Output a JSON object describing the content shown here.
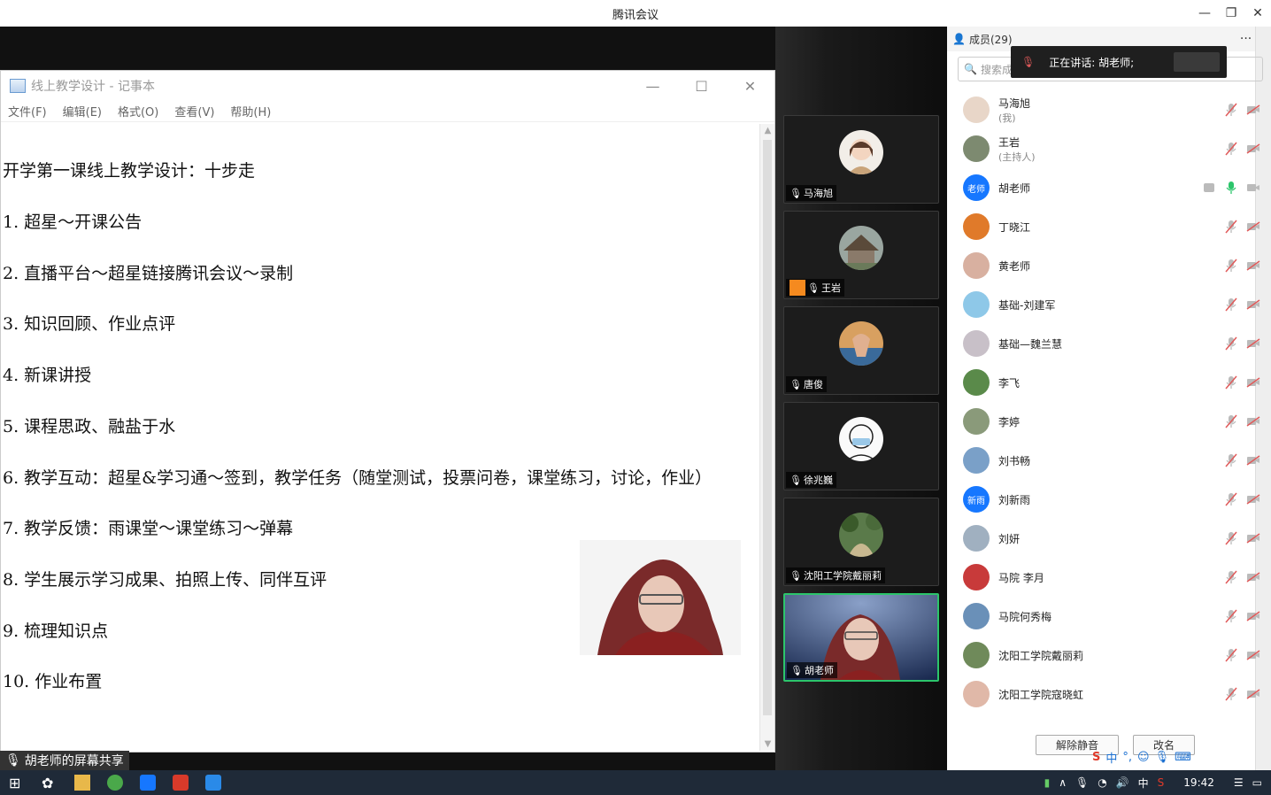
{
  "window": {
    "title": "腾讯会议",
    "min": "—",
    "max": "❐",
    "close": "✕"
  },
  "notepad": {
    "title": "线上教学设计 - 记事本",
    "menu": [
      "文件(F)",
      "编辑(E)",
      "格式(O)",
      "查看(V)",
      "帮助(H)"
    ],
    "lines": [
      "开学第一课线上教学设计：十步走",
      "1. 超星～开课公告",
      "2. 直播平台～超星链接腾讯会议～录制",
      "3. 知识回顾、作业点评",
      "4. 新课讲授",
      "5. 课程思政、融盐于水",
      "6. 教学互动：超星&学习通～签到，教学任务（随堂测试，投票问卷，课堂练习，讨论，作业）",
      "7. 教学反馈：雨课堂～课堂练习～弹幕",
      "8. 学生展示学习成果、拍照上传、同伴互评",
      "9. 梳理知识点",
      "10. 作业布置"
    ]
  },
  "share_label": "胡老师的屏幕共享",
  "video_tiles": [
    {
      "name": "马海旭",
      "color": "#d9c9b8"
    },
    {
      "name": "王岩",
      "color": "#7d8a70"
    },
    {
      "name": "唐俊",
      "color": "#c58a4a"
    },
    {
      "name": "徐兆巍",
      "color": "#f2f2f2"
    },
    {
      "name": "沈阳工学院戴丽莉",
      "color": "#6f8a5a"
    },
    {
      "name": "胡老师",
      "color": "#3a4a70"
    }
  ],
  "panel": {
    "title": "成员(29)",
    "more": "···",
    "close": "✕",
    "search_placeholder": "搜索成",
    "toast": "正在讲话: 胡老师;",
    "buttons": [
      "解除静音",
      "改名"
    ],
    "members": [
      {
        "name": "马海旭",
        "sub": "(我)",
        "avatar": "#e8d6c8",
        "label": ""
      },
      {
        "name": "王岩",
        "sub": "(主持人)",
        "avatar": "#7d8a70",
        "label": ""
      },
      {
        "name": "胡老师",
        "sub": "",
        "avatar": "#1677ff",
        "label": "老师",
        "speaking": true
      },
      {
        "name": "丁晓江",
        "sub": "",
        "avatar": "#e07a2a",
        "label": ""
      },
      {
        "name": "黄老师",
        "sub": "",
        "avatar": "#d8b0a0",
        "label": ""
      },
      {
        "name": "基础-刘建军",
        "sub": "",
        "avatar": "#8ec8e8",
        "label": ""
      },
      {
        "name": "基础—魏兰慧",
        "sub": "",
        "avatar": "#c8c0c8",
        "label": ""
      },
      {
        "name": "李飞",
        "sub": "",
        "avatar": "#5a8a4a",
        "label": ""
      },
      {
        "name": "李婷",
        "sub": "",
        "avatar": "#8a9a7a",
        "label": ""
      },
      {
        "name": "刘书畅",
        "sub": "",
        "avatar": "#7aa0c8",
        "label": ""
      },
      {
        "name": "刘新雨",
        "sub": "",
        "avatar": "#1677ff",
        "label": "新雨"
      },
      {
        "name": "刘妍",
        "sub": "",
        "avatar": "#a0b0c0",
        "label": ""
      },
      {
        "name": "马院 李月",
        "sub": "",
        "avatar": "#c83a3a",
        "label": ""
      },
      {
        "name": "马院何秀梅",
        "sub": "",
        "avatar": "#6a90b8",
        "label": ""
      },
      {
        "name": "沈阳工学院戴丽莉",
        "sub": "",
        "avatar": "#6f8a5a",
        "label": ""
      },
      {
        "name": "沈阳工学院寇晓虹",
        "sub": "",
        "avatar": "#e0b8a8",
        "label": ""
      }
    ]
  },
  "taskbar": {
    "time": "19:42",
    "ime": "中"
  },
  "colors": {
    "accent": "#1677ff",
    "speaking": "#2cc56b",
    "muted": "#e05a5a"
  }
}
